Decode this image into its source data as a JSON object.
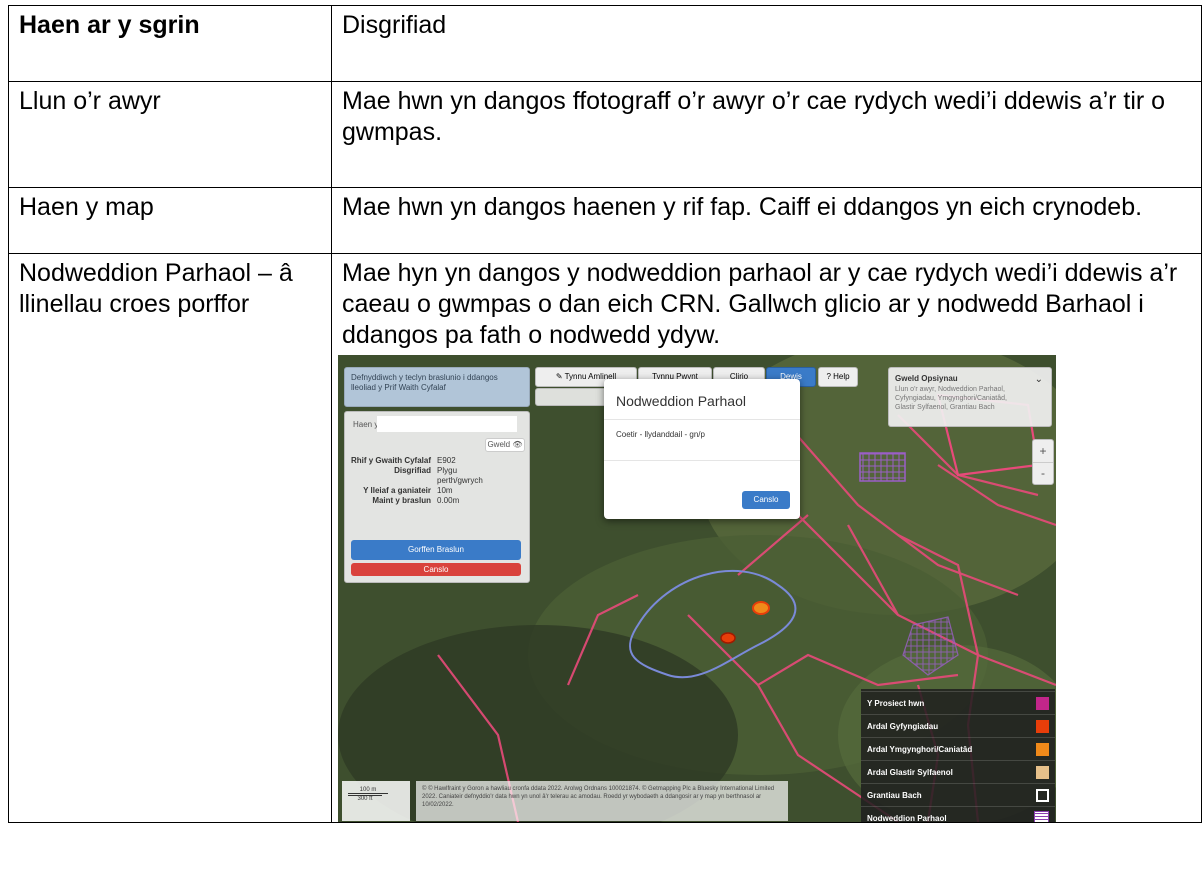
{
  "table": {
    "header": {
      "col1": "Haen ar y sgrin",
      "col2": "Disgrifiad"
    },
    "rows": [
      {
        "layer": "Llun o’r awyr",
        "description": "Mae hwn yn dangos ffotograff o’r awyr o’r cae rydych wedi’i ddewis a’r tir o gwmpas."
      },
      {
        "layer": "Haen y map",
        "description": "Mae hwn yn dangos haenen y rif fap. Caiff ei ddangos yn eich crynodeb."
      },
      {
        "layer": "Nodweddion Parhaol – â llinellau croes porffor",
        "description": "Mae hyn yn dangos y nodweddion parhaol ar y cae rydych wedi’i ddewis a’r caeau o gwmpas o dan eich CRN. Gallwch glicio ar y nodwedd Barhaol i ddangos pa fath o nodwedd ydyw."
      }
    ]
  },
  "map": {
    "info_text": "Defnyddiwch y teclyn braslunio i ddangos lleoliad y Prif Waith Cyfalaf",
    "toolbar": {
      "draw_outline": "Tynnu Amlinell",
      "draw_point": "Tynnu Pwynt",
      "clear": "Clirio",
      "select": "Dewis",
      "help": "? Help",
      "click_hint": "Clicio"
    },
    "sketch_panel": {
      "header": "Haen y map",
      "show": "Gweld",
      "fields": [
        {
          "label": "Rhif y Gwaith Cyfalaf",
          "value": "E902"
        },
        {
          "label": "Disgrifiad",
          "value": "Plygu perth/gwrych"
        },
        {
          "label": "Y lleiaf a ganiateir",
          "value": "10m"
        },
        {
          "label": "Maint y braslun",
          "value": "0.00m"
        }
      ],
      "finish_button": "Gorffen Braslun",
      "cancel_button": "Canslo"
    },
    "modal": {
      "title": "Nodweddion Parhaol",
      "body": "Coetir - llydanddail - gn/p",
      "cancel": "Canslo"
    },
    "options": {
      "title": "Gweld Opsiynau",
      "text": "Llun o'r awyr, Nodweddion Parhaol, Cyfyngiadau, Ymgynghori/Caniatâd, Glastir Sylfaenol, Grantiau Bach"
    },
    "zoom": {
      "in": "+",
      "out": "-"
    },
    "legend": [
      {
        "label": "Y Prosiect hwn",
        "color": "#c2268a"
      },
      {
        "label": "Ardal Gyfyngiadau",
        "color": "#e83e0a"
      },
      {
        "label": "Ardal Ymgynghori/Caniatâd",
        "color": "#f08a1a"
      },
      {
        "label": "Ardal Glastir Sylfaenol",
        "color": "#e6c08a"
      },
      {
        "label": "Grantiau Bach",
        "color": "#ffffff"
      },
      {
        "label": "Nodweddion Parhaol",
        "color": "#8a3fb0"
      }
    ],
    "scale": {
      "m": "100 m",
      "ft": "300 ft"
    },
    "copyright": "© © Hawlfraint y Goron a hawliau cronfa ddata 2022. Arolwg Ordnans 100021874. © Getmapping Plc a Bluesky International Limited 2022. Caniateir defnyddio'r data hwn yn unol â'r telerau ac amodau. Roedd yr wybodaeth a ddangosir ar y map yn berthnasol ar 10/02/2022."
  }
}
